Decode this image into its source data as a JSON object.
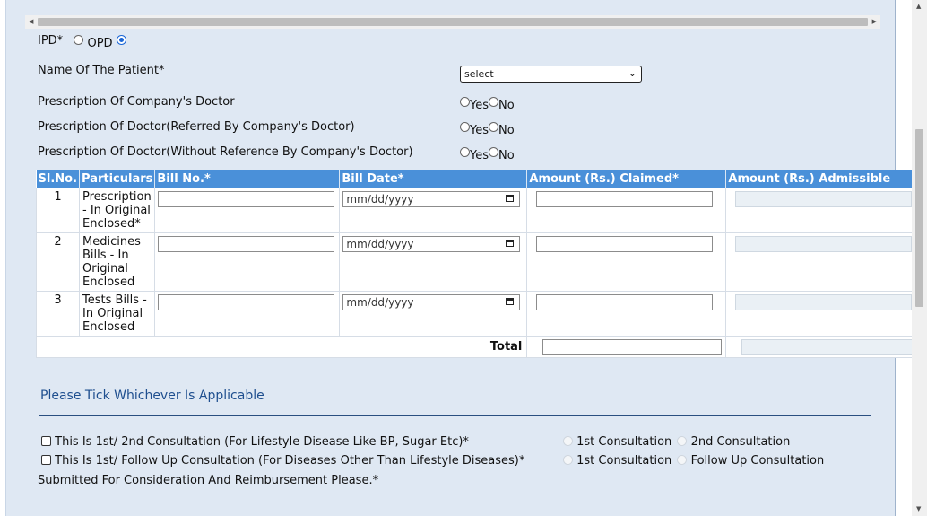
{
  "patient_type": {
    "ipd_label": "IPD*",
    "opd_label": "OPD",
    "selected": "OPD"
  },
  "patient_name": {
    "label": "Name Of The Patient*",
    "select_value": "select"
  },
  "prescriptions": [
    {
      "label": "Prescription Of Company's Doctor",
      "yes": "Yes",
      "no": "No"
    },
    {
      "label": "Prescription Of Doctor(Referred By Company's Doctor)",
      "yes": "Yes",
      "no": "No"
    },
    {
      "label": "Prescription Of Doctor(Without Reference By Company's Doctor)",
      "yes": "Yes",
      "no": "No"
    }
  ],
  "bills_table": {
    "headers": [
      "Sl.No.",
      "Particulars",
      "Bill No.*",
      "Bill Date*",
      "Amount (Rs.) Claimed*",
      "Amount (Rs.) Admissible"
    ],
    "date_placeholder": "mm/dd/yyyy",
    "rows": [
      {
        "sl": "1",
        "particulars": "Prescription - In Original Enclosed*"
      },
      {
        "sl": "2",
        "particulars": "Medicines Bills - In Original Enclosed"
      },
      {
        "sl": "3",
        "particulars": "Tests Bills - In Original Enclosed"
      }
    ],
    "total_label": "Total"
  },
  "applicable": {
    "title": "Please Tick Whichever Is Applicable",
    "lifestyle_label": "This Is 1st/ 2nd Consultation (For Lifestyle Disease Like BP, Sugar Etc)*",
    "lifestyle_opt1": "1st Consultation",
    "lifestyle_opt2": "2nd Consultation",
    "other_label": "This Is 1st/ Follow Up Consultation (For Diseases Other Than Lifestyle Diseases)*",
    "other_opt1": "1st Consultation",
    "other_opt2": "Follow Up Consultation",
    "submit_text": "Submitted For Consideration And Reimbursement Please.*"
  }
}
